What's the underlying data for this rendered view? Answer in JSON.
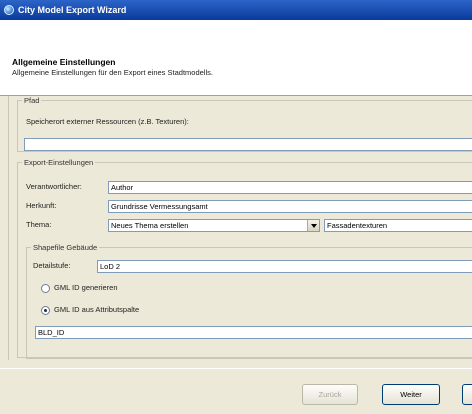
{
  "window": {
    "title": "City Model Export Wizard"
  },
  "header": {
    "title": "Allgemeine Einstellungen",
    "subtitle": "Allgemeine Einstellungen für den Export eines Stadtmodells."
  },
  "pfad": {
    "group_label": "Pfad",
    "storage_label": "Speicherort externer Ressourcen (z.B. Texturen):",
    "storage_value": ""
  },
  "export": {
    "group_label": "Export-Einstellungen",
    "responsible_label": "Verantwortlicher:",
    "responsible_value": "Author",
    "origin_label": "Herkunft:",
    "origin_value": "Grundrisse Vermessungsamt",
    "theme_label": "Thema:",
    "theme_selected": "Neues Thema erstellen",
    "theme_name_value": "Fassadentexturen"
  },
  "shapefile": {
    "group_label": "Shapefile Gebäude",
    "detail_label": "Detailstufe:",
    "detail_value": "LoD 2",
    "radio_generate_label": "GML ID generieren",
    "radio_attribute_label": "GML ID aus Attributspalte",
    "attribute_value": "BLD_ID"
  },
  "buttons": {
    "back": "Zurück",
    "next": "Weiter"
  }
}
